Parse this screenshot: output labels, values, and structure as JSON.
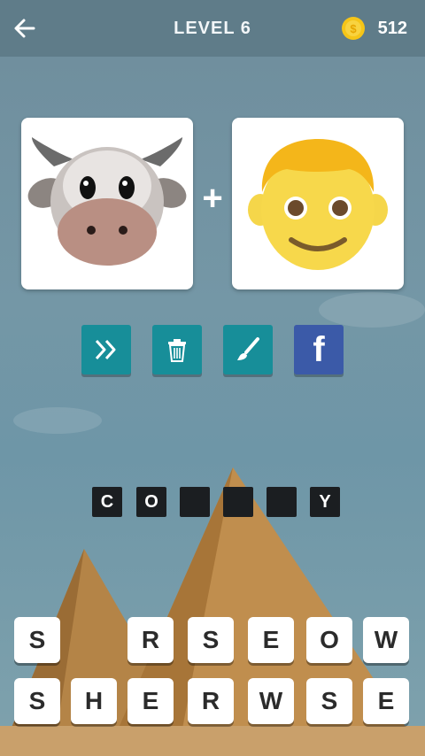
{
  "header": {
    "title": "LEVEL 6",
    "coins": "512",
    "coin_symbol": "$"
  },
  "puzzle": {
    "left_emoji": "cow-face",
    "operator": "+",
    "right_emoji": "boy-face"
  },
  "tools": [
    {
      "name": "skip",
      "icon": "double-chevron-icon",
      "color": "#178e99"
    },
    {
      "name": "delete",
      "icon": "trash-icon",
      "color": "#178e99"
    },
    {
      "name": "brush",
      "icon": "brush-icon",
      "color": "#178e99"
    },
    {
      "name": "facebook",
      "icon": "facebook-icon",
      "color": "#3b5aa8",
      "glyph": "f"
    }
  ],
  "answer": {
    "slots": [
      "C",
      "O",
      "",
      "",
      "",
      "Y"
    ]
  },
  "keyboard": {
    "row1": [
      "S",
      "",
      "R",
      "S",
      "E",
      "O",
      "W"
    ],
    "row2": [
      "S",
      "H",
      "E",
      "R",
      "W",
      "S",
      "E"
    ]
  }
}
